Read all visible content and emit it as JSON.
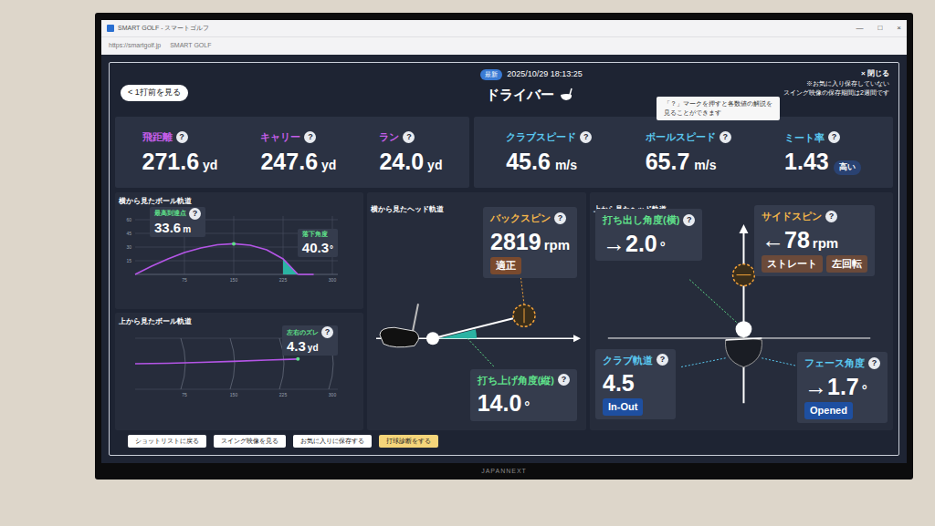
{
  "browser": {
    "title": "SMART GOLF - スマートゴルフ",
    "tab": "SMART GOLF",
    "url": "https://smartgolf.jp"
  },
  "window_controls": [
    "—",
    "□",
    "×"
  ],
  "help_mark": "?",
  "header": {
    "back_button": "< 1打前を見る",
    "latest_badge": "最新",
    "datetime": "2025/10/29 18:13:25",
    "club": "ドライバー",
    "close": "× 閉じる",
    "notice": [
      "※お気に入り保存していない",
      "スイング映像の保存期間は2週間です"
    ]
  },
  "tooltip": [
    "「？」マークを押すと各数値の解説を",
    "見ることができます"
  ],
  "distance_stats": [
    {
      "label": "飛距離",
      "value": "271.6",
      "unit": "yd"
    },
    {
      "label": "キャリー",
      "value": "247.6",
      "unit": "yd"
    },
    {
      "label": "ラン",
      "value": "24.0",
      "unit": "yd"
    }
  ],
  "speed_stats": [
    {
      "label": "クラブスピード",
      "value": "45.6",
      "unit": "m/s",
      "badge": ""
    },
    {
      "label": "ボールスピード",
      "value": "65.7",
      "unit": "m/s",
      "badge": ""
    },
    {
      "label": "ミート率",
      "value": "1.43",
      "unit": "",
      "badge": "高い"
    }
  ],
  "side_ball_path": {
    "title": "横から見たボール軌道",
    "apex_label": "最高到達点",
    "apex_value": "33.6",
    "apex_unit": "m",
    "landing_label": "落下角度",
    "landing_value": "40.3",
    "landing_unit": "°",
    "x_ticks": [
      "75",
      "150",
      "225",
      "300"
    ],
    "y_ticks": [
      "15",
      "30",
      "45",
      "60"
    ],
    "distance_yd": [
      0,
      25,
      50,
      75,
      100,
      125,
      150,
      175,
      200,
      225,
      247.6
    ],
    "height_m": [
      0,
      9,
      17,
      24,
      29,
      32.5,
      33.6,
      32,
      27,
      17,
      0
    ],
    "run_yd": [
      247.6,
      271.6
    ]
  },
  "top_ball_path": {
    "title": "上から見たボール軌道",
    "offset_label": "左右のズレ",
    "offset_value": "4.3",
    "offset_unit": "yd",
    "x_ticks": [
      "75",
      "150",
      "225",
      "300"
    ],
    "distance_yd": [
      0,
      50,
      100,
      150,
      200,
      247.6
    ],
    "offset_yd": [
      0,
      0.4,
      1.2,
      2.2,
      3.3,
      4.3
    ]
  },
  "side_head_path": {
    "title": "横から見たヘッド軌道",
    "backspin": {
      "label": "バックスピン",
      "value": "2819",
      "unit": "rpm",
      "badges": [
        "適正"
      ]
    },
    "launch_vertical": {
      "label": "打ち上げ角度(縦)",
      "value": "14.0",
      "unit": "°",
      "badges": []
    }
  },
  "top_head_path": {
    "title": "上から見たヘッド軌道",
    "launch_horizontal": {
      "label": "打ち出し角度(横)",
      "value": "→2.0",
      "unit": "°",
      "badges": []
    },
    "sidespin": {
      "label": "サイドスピン",
      "value": "←78",
      "unit": "rpm",
      "badges": [
        "ストレート",
        "左回転"
      ]
    },
    "club_path": {
      "label": "クラブ軌道",
      "value": "4.5",
      "unit": "",
      "badges": [
        "In-Out"
      ]
    },
    "face_angle": {
      "label": "フェース角度",
      "value": "→1.7",
      "unit": "°",
      "badges": [
        "Opened"
      ]
    }
  },
  "footer_buttons": [
    {
      "label": "ショットリストに戻る",
      "highlighted": false
    },
    {
      "label": "スイング映像を見る",
      "highlighted": false
    },
    {
      "label": "お気に入りに保存する",
      "highlighted": false
    },
    {
      "label": "打球診断をする",
      "highlighted": true
    }
  ],
  "monitor_brand": "JAPANNEXT"
}
